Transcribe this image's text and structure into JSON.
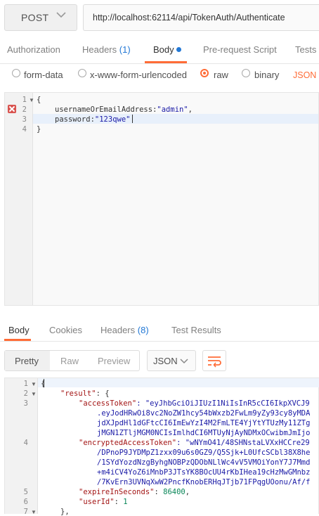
{
  "request": {
    "method": "POST",
    "url": "http://localhost:62114/api/TokenAuth/Authenticate"
  },
  "request_tabs": {
    "authorization": "Authorization",
    "headers": "Headers",
    "headers_count": "(1)",
    "body": "Body",
    "prerequest": "Pre-request Script",
    "tests": "Tests"
  },
  "body_types": {
    "form_data": "form-data",
    "urlencoded": "x-www-form-urlencoded",
    "raw": "raw",
    "binary": "binary",
    "selected": "raw",
    "content_type": "JSON (a"
  },
  "request_body": {
    "line_numbers": [
      "1",
      "2",
      "3",
      "4"
    ],
    "lines": [
      {
        "text": "{"
      },
      {
        "key": "usernameOrEmailAddress:",
        "value": "\"admin\"",
        "suffix": ","
      },
      {
        "key": "password:",
        "value": "\"123qwe\""
      },
      {
        "text": "}"
      }
    ]
  },
  "response_tabs": {
    "body": "Body",
    "cookies": "Cookies",
    "headers": "Headers",
    "headers_count": "(8)",
    "test_results": "Test Results"
  },
  "response_view": {
    "pretty": "Pretty",
    "raw": "Raw",
    "preview": "Preview",
    "format": "JSON"
  },
  "response_body": {
    "line_numbers": [
      "1",
      "2",
      "3",
      "",
      "",
      "",
      "4",
      "",
      "",
      "",
      "",
      "5",
      "6",
      "7"
    ],
    "l1": "{",
    "l2_key": "\"result\"",
    "l2_rest": ": {",
    "l3_key": "\"accessToken\"",
    "l3_val": ": \"eyJhbGciOiJIUzI1NiIsInR5cCI6IkpXVCJ9",
    "l3_c1": ".eyJodHRwOi8vc2NoZW1hcy54bWxzb2FwLm9yZy93cy8yMDA",
    "l3_c2": "jdXJpdHl1dGFtcCI6ImEwYzI4M2FmLTE4YjYtYTUzMy11ZTg",
    "l3_c3": "jMGN1ZTljMGM0NCIsImlhdCI6MTUyNjAyNDMxOCwibmJmIjo",
    "l4_key": "\"encryptedAccessToken\"",
    "l4_val": ": \"wNYmO41/48SHNstaLVXxHCCre29",
    "l4_c1": "/DPnoP9JYDMpZ1zxx09u6s0GZ9/Q5Sjk+L0UfcSCbl38X8he",
    "l4_c2": "/1SYdYozdNzgByhgNOBPzQDObNLlWc4vV5VMOiYonY7J7Mmd",
    "l4_c3": "+m4iCV4YoZ6iMnbP3JTsYK8BOcUU4rKbIHea19cHzMwGMnbz",
    "l4_c4": "/7KvErn3UVNqXwW2PncfKnobERHqJTjb71FPqgUOonu/Af/f",
    "l5_key": "\"expireInSeconds\"",
    "l5_val": "86400",
    "l6_key": "\"userId\"",
    "l6_val": "1",
    "l7": "},"
  },
  "colors": {
    "accent": "#ff6c37",
    "link": "#2378d5",
    "error": "#d9534f"
  }
}
